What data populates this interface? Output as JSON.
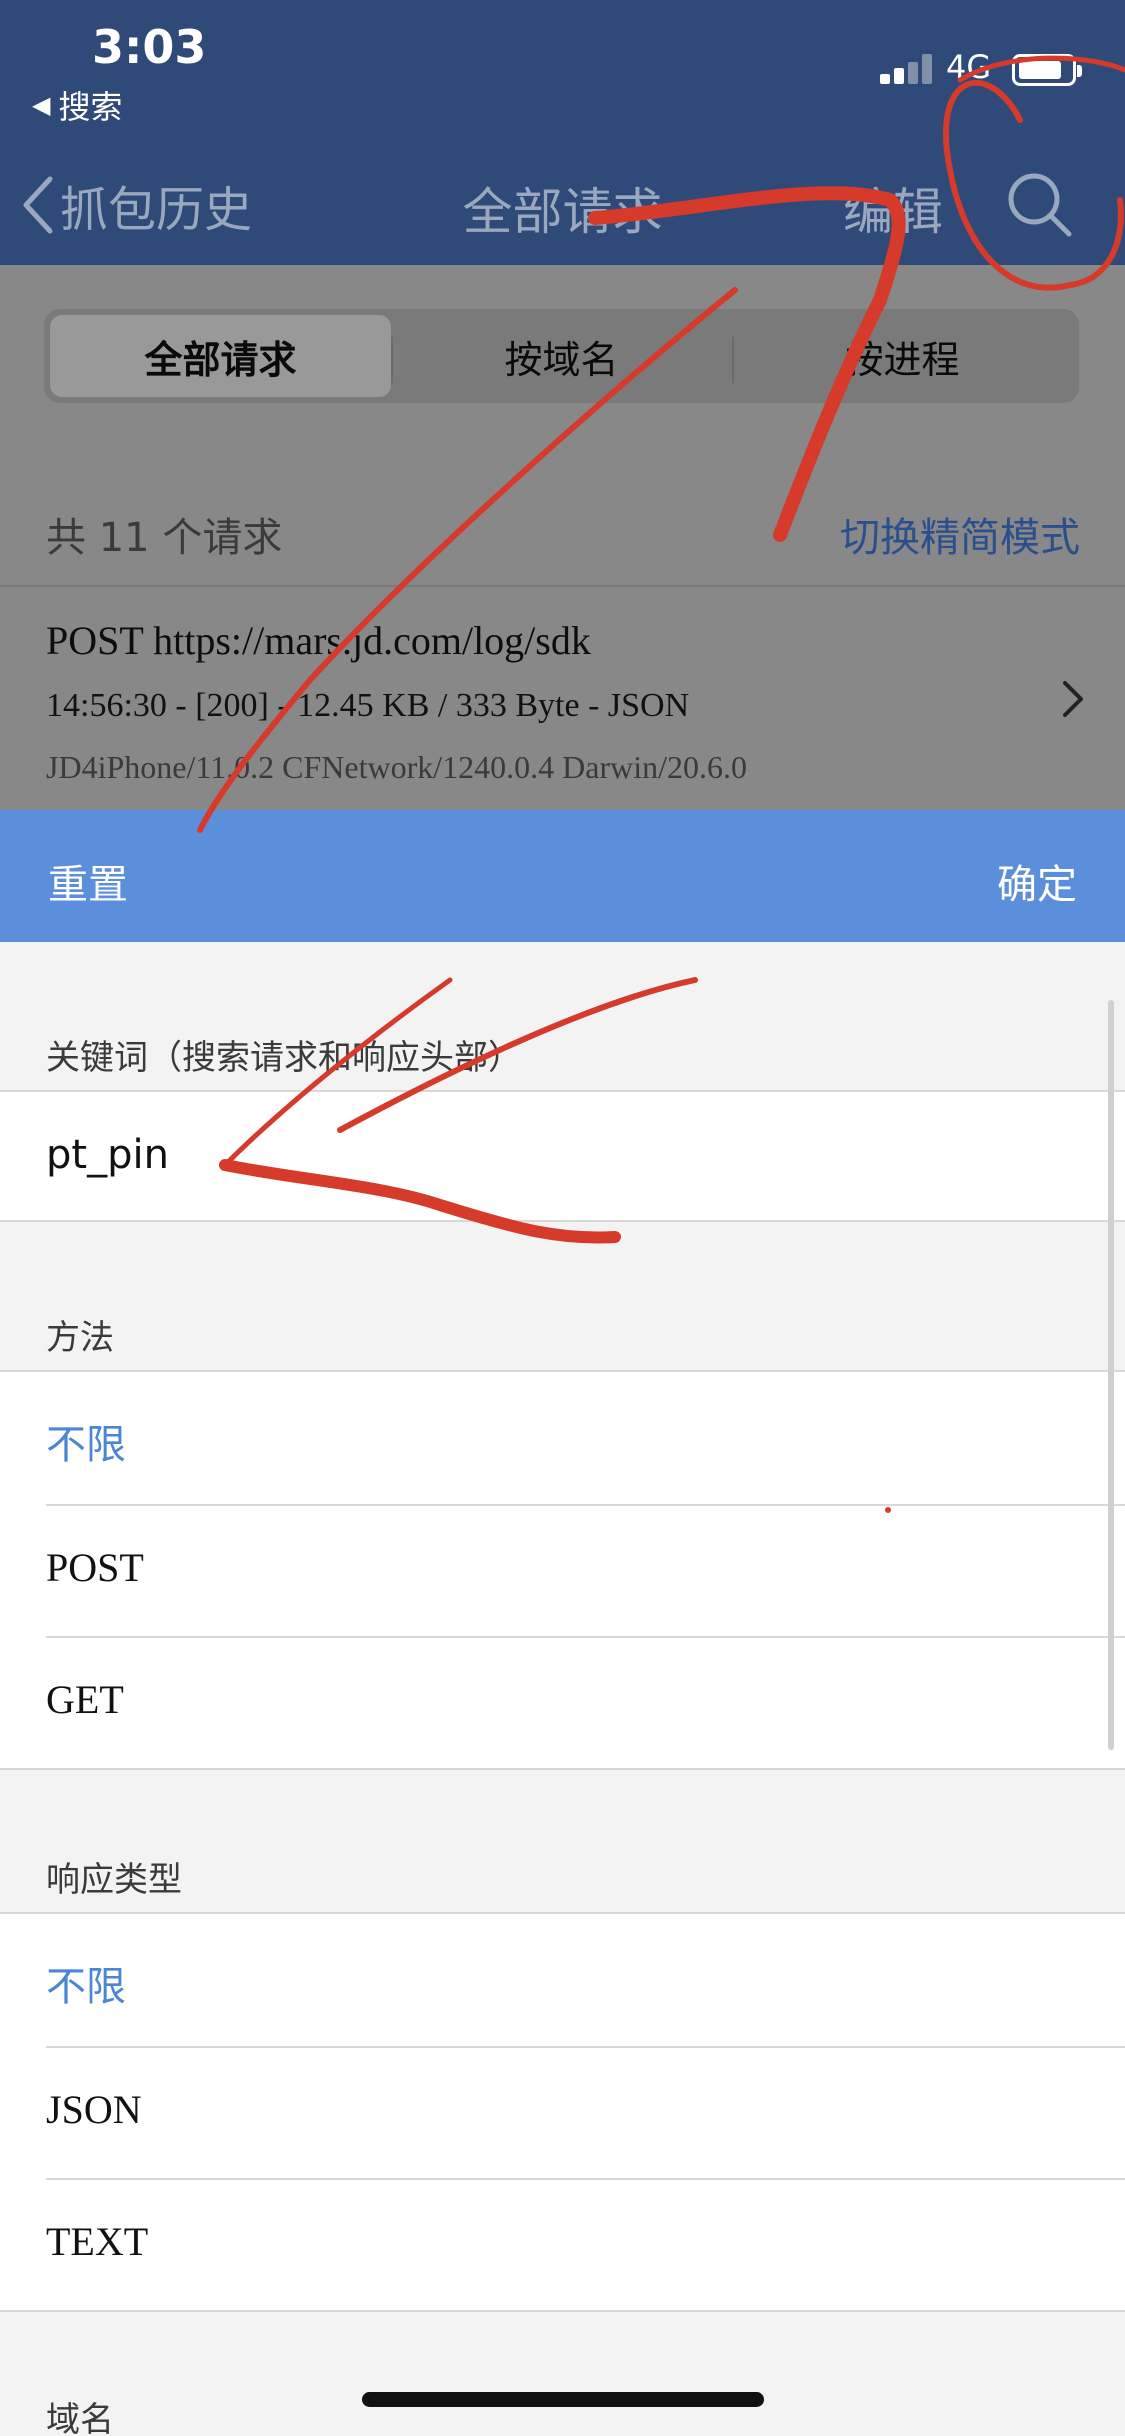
{
  "status_bar": {
    "time": "3:03",
    "back_app": "搜索",
    "network": "4G"
  },
  "navbar": {
    "back_label": "抓包历史",
    "title": "全部请求",
    "edit_label": "编辑",
    "search_icon": "search-icon"
  },
  "segments": [
    {
      "label": "全部请求",
      "active": true
    },
    {
      "label": "按域名",
      "active": false
    },
    {
      "label": "按进程",
      "active": false
    }
  ],
  "request_count": "共 11 个请求",
  "switch_mode": "切换精简模式",
  "request": {
    "line1": "POST https://mars.jd.com/log/sdk",
    "line2": "14:56:30 - [200] - 12.45 KB / 333 Byte - JSON",
    "line3": "JD4iPhone/11.0.2 CFNetwork/1240.0.4 Darwin/20.6.0"
  },
  "action_bar": {
    "reset": "重置",
    "confirm": "确定"
  },
  "keyword": {
    "label": "关键词（搜索请求和响应头部）",
    "value": "pt_pin"
  },
  "method": {
    "label": "方法",
    "options": [
      "不限",
      "POST",
      "GET"
    ],
    "selected": "不限"
  },
  "response_type": {
    "label": "响应类型",
    "options": [
      "不限",
      "JSON",
      "TEXT"
    ],
    "selected": "不限"
  },
  "domain": {
    "label": "域名"
  },
  "colors": {
    "nav_bg": "#2f4a79",
    "action_bar_bg": "#5b8fdb",
    "selected_option": "#4b86d6",
    "annotation_red": "#d63a2a"
  }
}
